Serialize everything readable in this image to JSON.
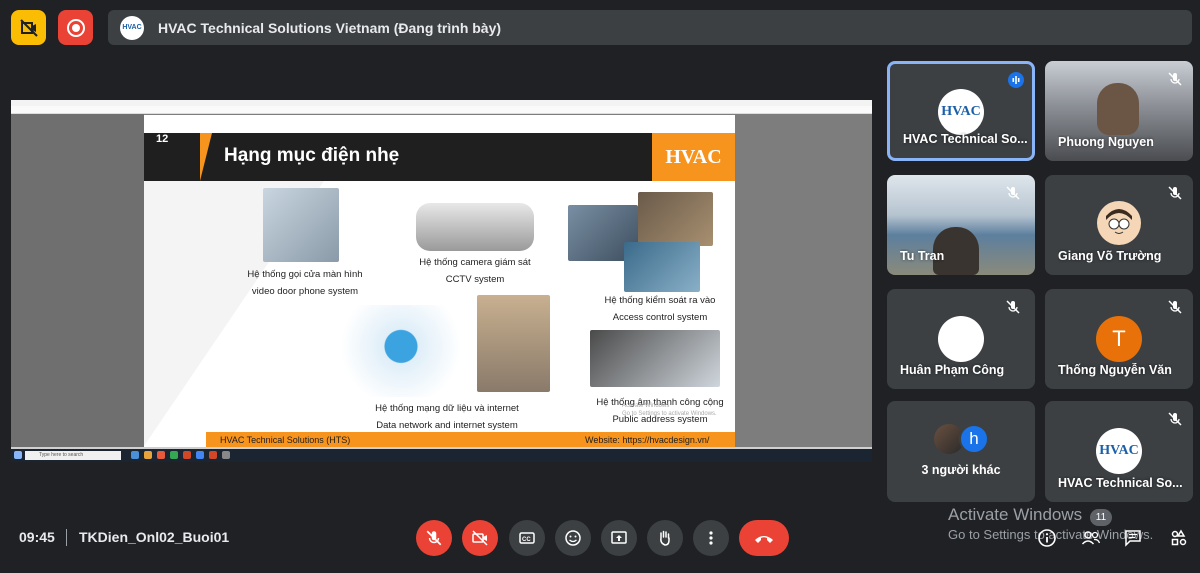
{
  "colors": {
    "background": "#202124",
    "accent": "#8ab4f8",
    "danger": "#ea4335",
    "slide_orange": "#f7941d",
    "warning_yellow": "#fbbc04"
  },
  "banner": {
    "title": "HVAC Technical Solutions Vietnam (Đang trình bày)",
    "logo_text": "HVAC"
  },
  "slide": {
    "number": "12",
    "title": "Hạng mục điện nhẹ",
    "logo_text": "HVAC",
    "captions": [
      {
        "vi": "Hệ thống gọi cửa màn hình",
        "en": "video door phone system"
      },
      {
        "vi": "Hệ thống camera giám sát",
        "en": "CCTV system"
      },
      {
        "vi": "Hệ thống kiểm soát ra vào",
        "en": "Access control system"
      },
      {
        "vi": "Hệ thống mạng dữ liệu và internet",
        "en": "Data network and internet system"
      },
      {
        "vi": "Hệ thống âm thanh công cộng",
        "en": "Public address system"
      }
    ],
    "footer_left": "HVAC Technical Solutions (HTS)",
    "footer_right": "Website: https://hvacdesign.vn/",
    "watermark_line1": "Activate Windows",
    "watermark_line2": "Go to Settings to activate Windows."
  },
  "screen": {
    "taskbar_search": "Type here to search"
  },
  "participants": [
    {
      "name": "HVAC Technical Solutions Vietnam",
      "display": "HVAC Technical So...",
      "type": "logo",
      "speaking": true
    },
    {
      "name": "Phuong Nguyen",
      "display": "Phuong Nguyen",
      "type": "video",
      "muted": true
    },
    {
      "name": "Tu Tran",
      "display": "Tu Tran",
      "type": "video",
      "muted": true
    },
    {
      "name": "Giang Võ Trường",
      "display": "Giang Võ Trường",
      "type": "avatar",
      "muted": true
    },
    {
      "name": "Huân Phạm Công",
      "display": "Huân Phạm Công",
      "type": "avatar",
      "muted": true
    },
    {
      "name": "Thống Nguyễn Văn",
      "display": "Thống Nguyễn Văn",
      "type": "initial",
      "initial": "T",
      "avatar_color": "#e8710a",
      "muted": true
    },
    {
      "name": "3 người khác",
      "display": "3 người khác",
      "type": "group",
      "initial": "h",
      "avatar_color": "#1a73e8"
    },
    {
      "name": "HVAC Technical Solutions",
      "display": "HVAC Technical So...",
      "type": "logo",
      "muted": true
    }
  ],
  "bottom": {
    "time": "09:45",
    "meeting_code": "TKDien_Onl02_Buoi01",
    "activate_title": "Activate Windows",
    "activate_sub": "Go to Settings to activate Windows.",
    "people_badge": "11"
  }
}
